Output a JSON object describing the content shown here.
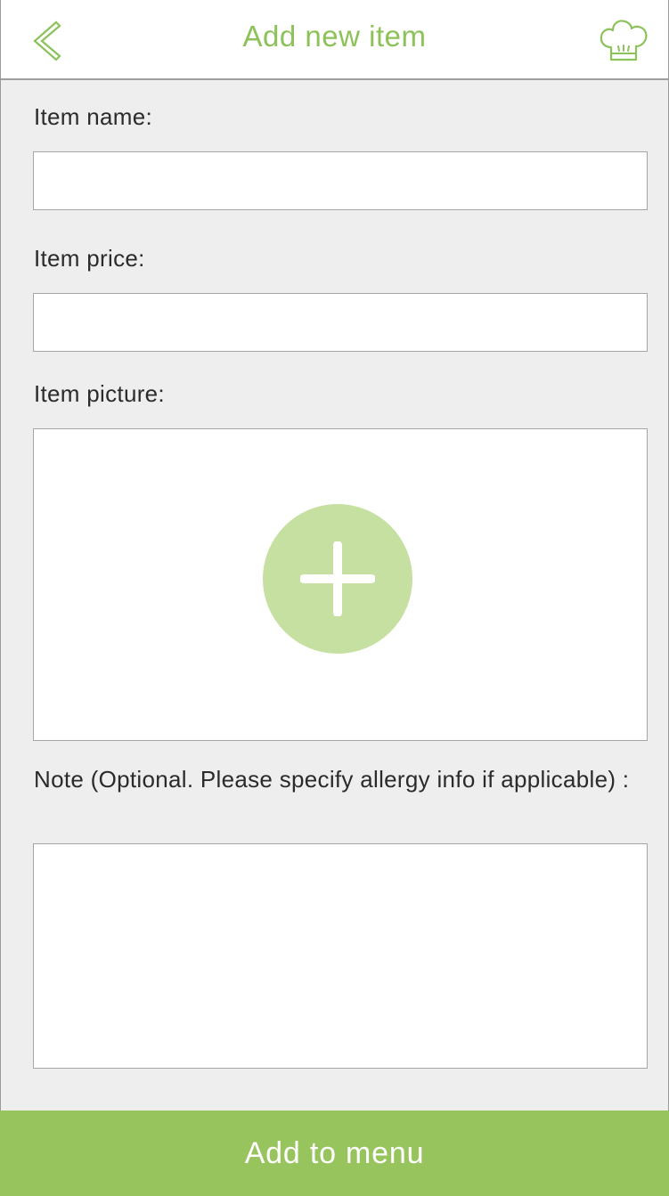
{
  "header": {
    "title": "Add new item",
    "back_icon": "chevron-left-icon",
    "right_icon": "chef-hat-icon"
  },
  "form": {
    "name_label": "Item name:",
    "name_value": "",
    "price_label": "Item price:",
    "price_value": "",
    "picture_label": "Item picture:",
    "add_picture_icon": "plus-icon",
    "note_label": "Note (Optional. Please specify allergy info if applicable) :",
    "note_value": ""
  },
  "footer": {
    "button_label": "Add to menu"
  },
  "colors": {
    "accent": "#8dc15a",
    "accent_light": "#c5e0a0",
    "button_bg": "#98c45e",
    "background": "#eeeeef",
    "field_border": "#a6a6a6",
    "text": "#2b2b2b"
  }
}
